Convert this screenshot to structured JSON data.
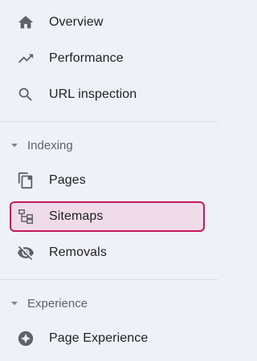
{
  "nav": {
    "top_items": [
      {
        "label": "Overview",
        "icon": "home-icon"
      },
      {
        "label": "Performance",
        "icon": "trending-up-icon"
      },
      {
        "label": "URL inspection",
        "icon": "search-icon"
      }
    ],
    "indexing": {
      "header": "Indexing",
      "items": [
        {
          "label": "Pages",
          "icon": "pages-icon"
        },
        {
          "label": "Sitemaps",
          "icon": "sitemap-icon",
          "active": true
        },
        {
          "label": "Removals",
          "icon": "visibility-off-icon"
        }
      ]
    },
    "experience": {
      "header": "Experience",
      "items": [
        {
          "label": "Page Experience",
          "icon": "page-experience-icon"
        }
      ]
    }
  },
  "colors": {
    "background": "#eef2f8",
    "active_border": "#c2185b",
    "active_fill": "#f0dce9",
    "icon": "#5f6368",
    "divider": "#dadce0"
  }
}
